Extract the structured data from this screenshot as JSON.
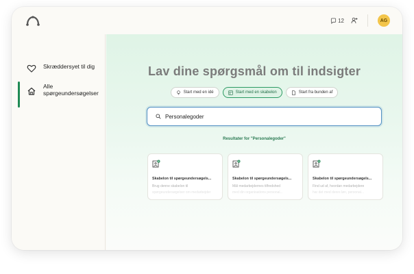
{
  "topbar": {
    "comment_count": "12",
    "avatar_initials": "AG"
  },
  "sidebar": {
    "items": [
      {
        "label": "Skræddersyet til dig",
        "icon": "heart-icon"
      },
      {
        "label": "Alle spørgeundersøgelser",
        "icon": "home-icon",
        "active": true
      }
    ]
  },
  "main": {
    "headline": "Lav dine spørgsmål om til indsigter",
    "chips": [
      {
        "label": "Start med en idé",
        "icon": "lightbulb-icon"
      },
      {
        "label": "Start med en skabelon",
        "icon": "template-icon",
        "active": true
      },
      {
        "label": "Start fra bunden af",
        "icon": "document-icon"
      }
    ],
    "search": {
      "value": "Personalegoder",
      "placeholder": ""
    },
    "results_label": "Resultater for \"Personalegoder\"",
    "cards": [
      {
        "title": "Skabelon til spørgeundersøgels...",
        "desc": "Brug denne skabelon til",
        "desc2": "spørgeundersøgelser om medarbejder"
      },
      {
        "title": "Skabelon til spørgeundersøgels...",
        "desc": "Mål medarbejdernes tilfredshed",
        "desc2": "med din organisations personal..."
      },
      {
        "title": "Skabelon til spørgeundersøgels...",
        "desc": "Find ud af, hvordan medarbejdere",
        "desc2": "har det med deres løn, personal..."
      }
    ]
  },
  "colors": {
    "accent": "#1f8a55",
    "avatar": "#f3c54a",
    "search_border": "#4f8fc2"
  }
}
